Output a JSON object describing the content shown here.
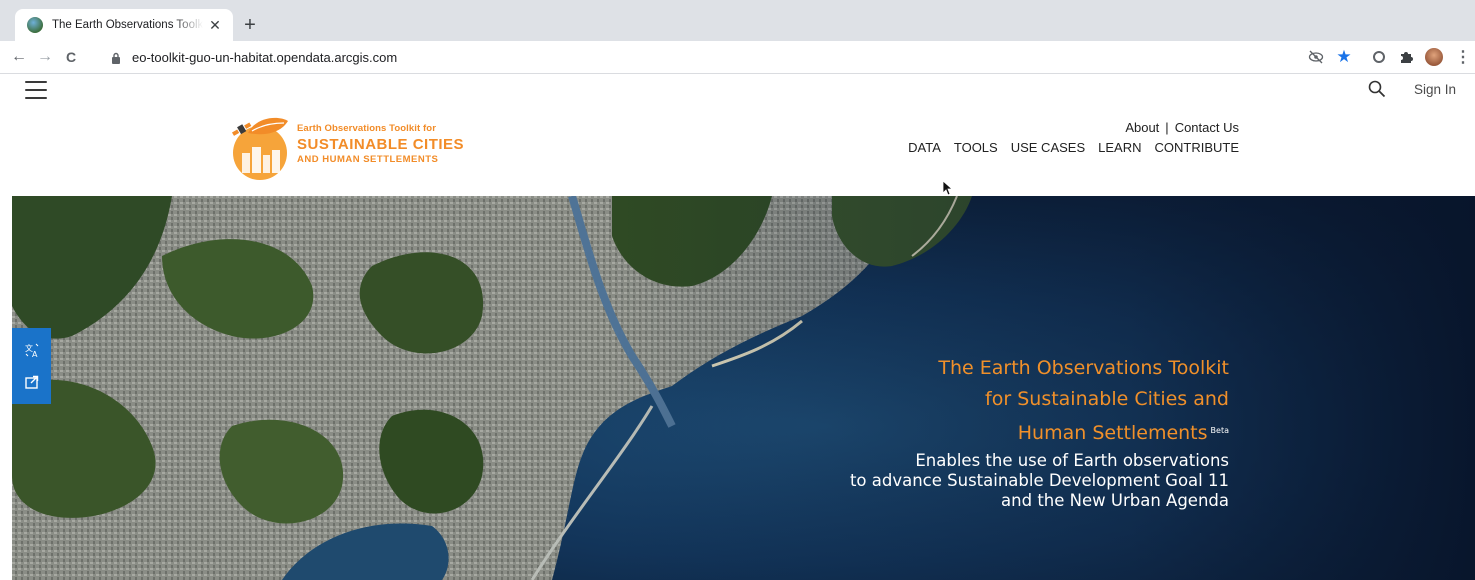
{
  "browser": {
    "tab_title": "The Earth Observations Toolkit",
    "tab_close": "✕",
    "new_tab": "+",
    "back": "←",
    "forward": "→",
    "reload": "C",
    "url": "eo-toolkit-guo-un-habitat.opendata.arcgis.com"
  },
  "header": {
    "sign_in": "Sign In",
    "logo": {
      "line1": "Earth Observations Toolkit for",
      "line2": "SUSTAINABLE CITIES",
      "line3": "AND HUMAN SETTLEMENTS"
    },
    "top_links": [
      {
        "label": "About"
      },
      {
        "label": "|"
      },
      {
        "label": "Contact Us"
      }
    ],
    "nav": [
      {
        "label": "DATA"
      },
      {
        "label": "TOOLS"
      },
      {
        "label": "USE CASES"
      },
      {
        "label": "LEARN"
      },
      {
        "label": "CONTRIBUTE"
      }
    ]
  },
  "hero": {
    "title_line1": "The Earth Observations Toolkit",
    "title_line2": "for Sustainable Cities and",
    "title_line3": "Human Settlements",
    "beta": "Beta",
    "sub_line1": "Enables the use of Earth observations",
    "sub_line2": "to advance Sustainable Development Goal 11",
    "sub_line3": "and the New Urban Agenda"
  },
  "colors": {
    "accent_orange": "#f28c28",
    "side_tools_blue": "#1a73c9",
    "bookmark_star": "#1a73e8"
  },
  "icons": [
    "translate-icon",
    "share-icon",
    "search-icon",
    "hamburger-icon",
    "lock-icon",
    "star-icon",
    "puzzle-icon"
  ]
}
